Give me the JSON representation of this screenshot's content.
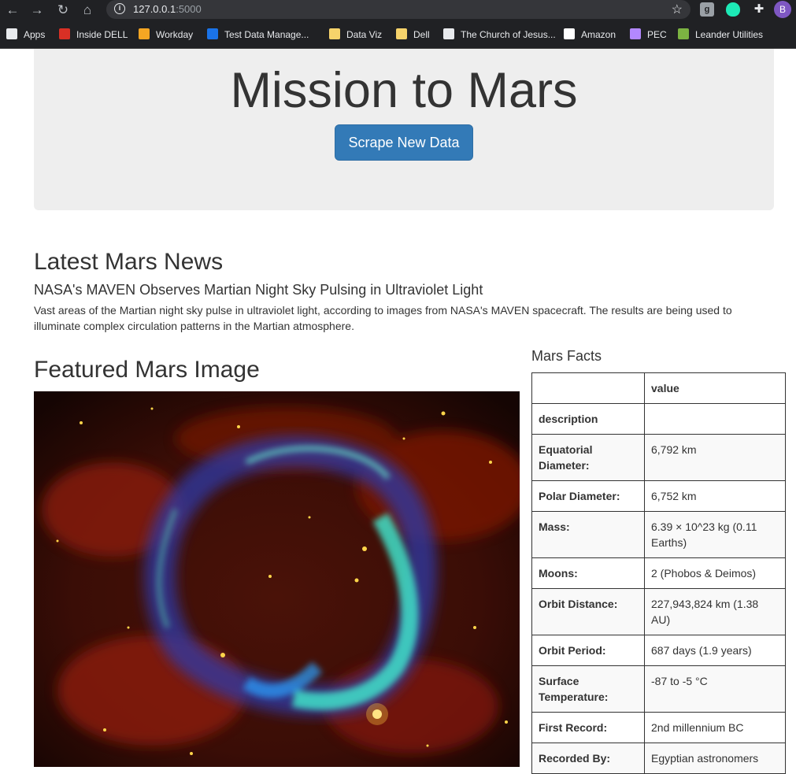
{
  "browser": {
    "url_host": "127.0.0.1",
    "url_port": ":5000",
    "profile_initial": "B",
    "bookmarks": [
      {
        "label": "Apps",
        "icon": "apps-grid-icon",
        "color": "#e8eaed"
      },
      {
        "label": "Inside DELL",
        "icon": "pf-icon",
        "color": "#d93025"
      },
      {
        "label": "Workday",
        "icon": "workday-icon",
        "color": "#f5a623"
      },
      {
        "label": "Test Data Manage...",
        "icon": "dell-icon",
        "color": "#1a73e8"
      },
      {
        "label": "Data Viz",
        "icon": "folder-icon",
        "color": "#f6d36b"
      },
      {
        "label": "Dell",
        "icon": "folder-icon",
        "color": "#f6d36b"
      },
      {
        "label": "The Church of Jesus...",
        "icon": "globe-icon",
        "color": "#e8eaed"
      },
      {
        "label": "Amazon",
        "icon": "amazon-icon",
        "color": "#ffffff"
      },
      {
        "label": "PEC",
        "icon": "pec-icon",
        "color": "#b388ff"
      },
      {
        "label": "Leander Utilities",
        "icon": "leander-icon",
        "color": "#7cb342"
      }
    ]
  },
  "page": {
    "title": "Mission to Mars",
    "scrape_button": "Scrape New Data",
    "news": {
      "section_title": "Latest Mars News",
      "headline": "NASA's MAVEN Observes Martian Night Sky Pulsing in Ultraviolet Light",
      "body": "Vast areas of the Martian night sky pulse in ultraviolet light, according to images from NASA's MAVEN spacecraft. The results are being used to illuminate complex circulation patterns in the Martian atmosphere."
    },
    "featured": {
      "section_title": "Featured Mars Image"
    },
    "facts": {
      "section_title": "Mars Facts",
      "header_value": "value",
      "rows": [
        {
          "key": "description",
          "value": ""
        },
        {
          "key": "Equatorial Diameter:",
          "value": "6,792 km"
        },
        {
          "key": "Polar Diameter:",
          "value": "6,752 km"
        },
        {
          "key": "Mass:",
          "value": "6.39 × 10^23 kg (0.11 Earths)"
        },
        {
          "key": "Moons:",
          "value": "2 (Phobos & Deimos)"
        },
        {
          "key": "Orbit Distance:",
          "value": "227,943,824 km (1.38 AU)"
        },
        {
          "key": "Orbit Period:",
          "value": "687 days (1.9 years)"
        },
        {
          "key": "Surface Temperature:",
          "value": "-87 to -5 °C"
        },
        {
          "key": "First Record:",
          "value": "2nd millennium BC"
        },
        {
          "key": "Recorded By:",
          "value": "Egyptian astronomers"
        }
      ]
    }
  }
}
